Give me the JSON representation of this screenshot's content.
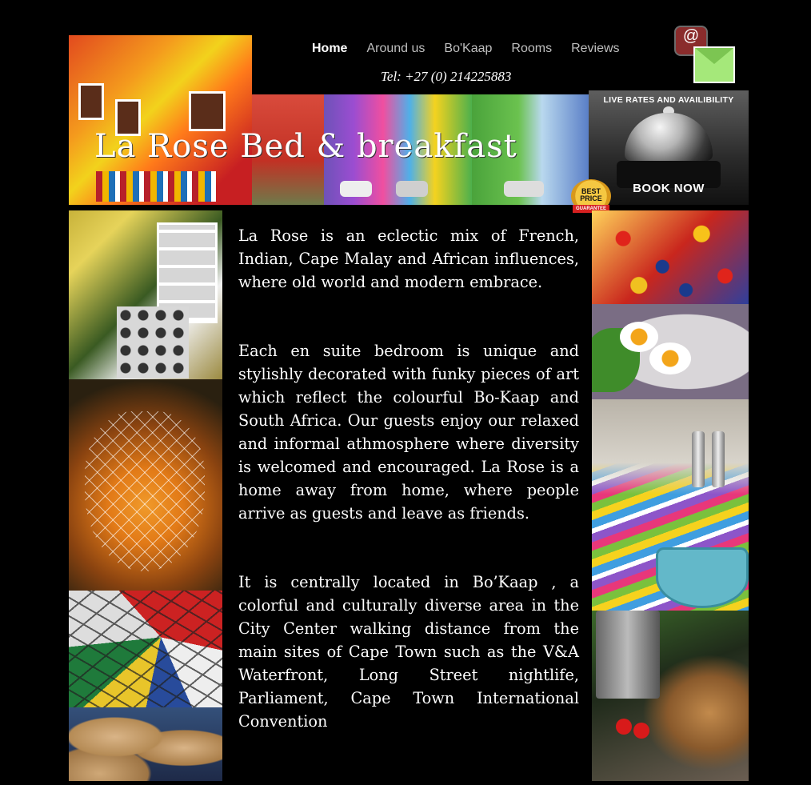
{
  "nav": {
    "items": [
      {
        "label": "Home",
        "active": true
      },
      {
        "label": "Around us",
        "active": false
      },
      {
        "label": "Bo'Kaap",
        "active": false
      },
      {
        "label": "Rooms",
        "active": false
      },
      {
        "label": "Reviews",
        "active": false
      }
    ],
    "tel": "Tel:  +27 (0) 214225883"
  },
  "header": {
    "brand": "La Rose Bed & breakfast",
    "best_price": {
      "line1": "BEST",
      "line2": "PRICE",
      "ribbon": "GUARANTEE"
    },
    "booking": {
      "title": "LIVE RATES AND AVAILIBILITY",
      "button": "BOOK NOW"
    },
    "mail_symbol": "@"
  },
  "content": {
    "paragraphs": [
      "La Rose is an eclectic mix of French, Indian, Cape Malay and African influences, where old world and modern embrace.",
      "Each en suite bedroom is unique and stylishly decorated with funky pieces of art which reflect the colourful Bo-Kaap and South Africa. Our guests enjoy our  relaxed and informal athmosphere where diversity is welcomed and encouraged. La Rose is a home away from home, where people arrive as guests and leave as friends.",
      "It is centrally located in Bo’Kaap , a colorful and culturally diverse area in the City Center walking distance from the main sites of Cape Town such as the V&A Waterfront, Long Street nightlife, Parliament, Cape Town International Convention"
    ]
  },
  "colors": {
    "background": "#000000",
    "nav_active": "#ffffff",
    "nav_inactive": "#bfbfbf",
    "mail_envelope": "#a5e87a"
  }
}
